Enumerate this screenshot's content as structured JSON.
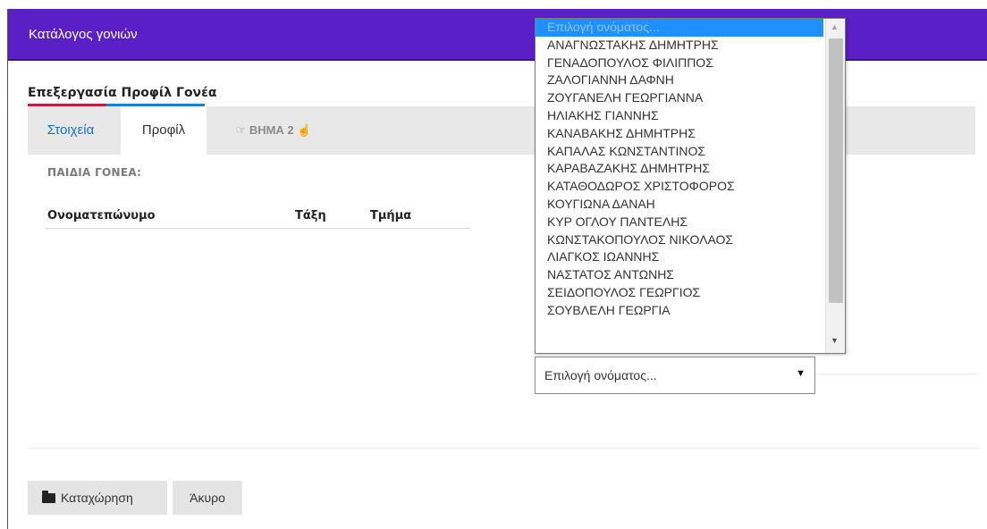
{
  "header": {
    "title": "Κατάλογος γονιών"
  },
  "form": {
    "heading": "Επεξεργασία Προφίλ Γονέα",
    "tabs": [
      {
        "label": "Στοιχεία"
      },
      {
        "label": "Προφίλ"
      },
      {
        "label": "ΒΗΜΑ 2",
        "left_icon": "hand-right-icon",
        "right_icon": "hand-up-icon"
      }
    ],
    "children_label": "ΠΑΙΔΙΑ ΓΟΝΕΑ:",
    "table": {
      "columns": [
        "Ονοματεπώνυμο",
        "Τάξη",
        "Τμήμα"
      ]
    }
  },
  "select": {
    "value": "Επιλογή ονόματος...",
    "options": [
      "Επιλογή ονόματος...",
      "ΑΝΑΓΝΩΣΤΑΚΗΣ ΔΗΜΗΤΡΗΣ",
      "ΓΕΝΑΔΟΠΟΥΛΟΣ ΦΙΛΙΠΠΟΣ",
      "ΖΑΛΟΓΙΑΝΝΗ ΔΑΦΝΗ",
      "ΖΟΥΓΑΝΕΛΗ  ΓΕΩΡΓΙΑΝΝΑ",
      "ΗΛΙΑΚΗΣ ΓΙΑΝΝΗΣ",
      "ΚΑΝΑΒΑΚΗΣ ΔΗΜΗΤΡΗΣ",
      "ΚΑΠΑΛΑΣ ΚΩΝΣΤΑΝΤΙΝΟΣ",
      "ΚΑΡΑΒΑΖΑΚΗΣ ΔΗΜΗΤΡΗΣ",
      "ΚΑΤΑΘΟΔΩΡΟΣ ΧΡΙΣΤΟΦΟΡΟΣ",
      "ΚΟΥΓΙΩΝΑ ΔΑΝΑΗ",
      "ΚΥΡ ΟΓΛΟΥ ΠΑΝΤΕΛΗΣ",
      "ΚΩΝΣΤΑΚΟΠΟΥΛΟΣ ΝΙΚΟΛΑΟΣ",
      "ΛΙΑΓΚΟΣ ΙΩΑΝΝΗΣ",
      "ΝΑΣΤΑΤΟΣ ΑΝΤΩΝΗΣ",
      "ΣΕΙΔΟΠΟΥΛΟΣ ΓΕΩΡΓΙΟΣ",
      "ΣΟΥΒΛΕΛΗ ΓΕΩΡΓΙΑ"
    ],
    "highlighted_index": 0
  },
  "buttons": {
    "save": "Καταχώρηση",
    "cancel": "Άκυρο"
  },
  "colors": {
    "header_bg": "#5b1fc7",
    "accent_red": "#b4243c",
    "accent_blue": "#1a7fd1",
    "highlight": "#1e90ff"
  },
  "icons": {
    "save_button": "folder-icon",
    "select_caret": "caret-down-icon"
  }
}
